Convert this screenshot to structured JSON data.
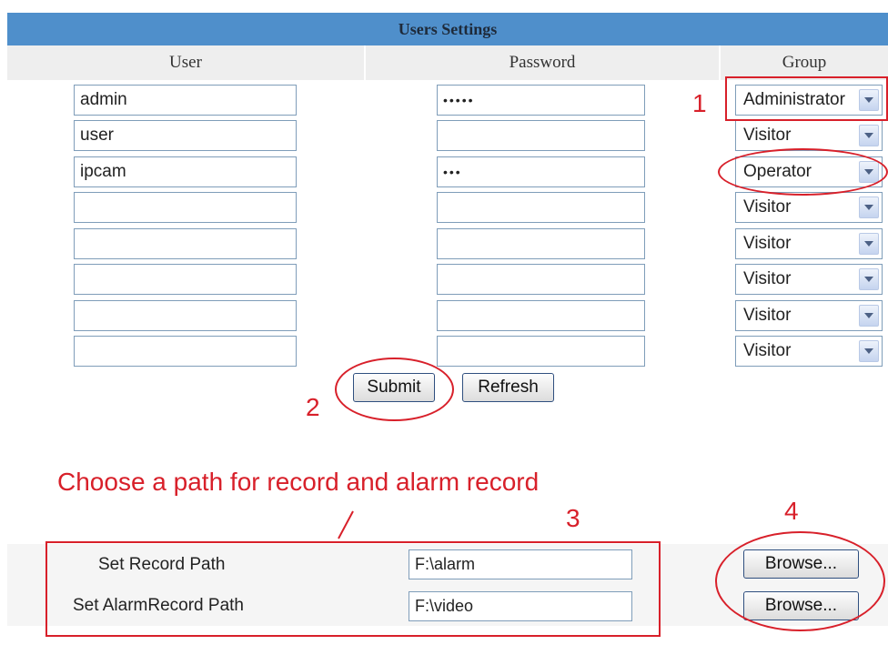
{
  "users_settings": {
    "title": "Users Settings",
    "columns": [
      "User",
      "Password",
      "Group"
    ],
    "rows": [
      {
        "user": "admin",
        "password": "•••••",
        "group": "Administrator"
      },
      {
        "user": "user",
        "password": "",
        "group": "Visitor"
      },
      {
        "user": "ipcam",
        "password": "•••",
        "group": "Operator"
      },
      {
        "user": "",
        "password": "",
        "group": "Visitor"
      },
      {
        "user": "",
        "password": "",
        "group": "Visitor"
      },
      {
        "user": "",
        "password": "",
        "group": "Visitor"
      },
      {
        "user": "",
        "password": "",
        "group": "Visitor"
      },
      {
        "user": "",
        "password": "",
        "group": "Visitor"
      }
    ],
    "submit_label": "Submit",
    "refresh_label": "Refresh"
  },
  "record_paths": {
    "record_label": "Set Record Path",
    "record_value": "F:\\alarm",
    "alarm_label": "Set AlarmRecord Path",
    "alarm_value": "F:\\video",
    "browse_label": "Browse..."
  },
  "annotations": {
    "marker_1": "1",
    "marker_2": "2",
    "marker_3": "3",
    "marker_4": "4",
    "caption": "Choose a path for record and alarm record"
  },
  "colors": {
    "header_blue": "#4f8fcb",
    "annotation_red": "#d8202a"
  }
}
